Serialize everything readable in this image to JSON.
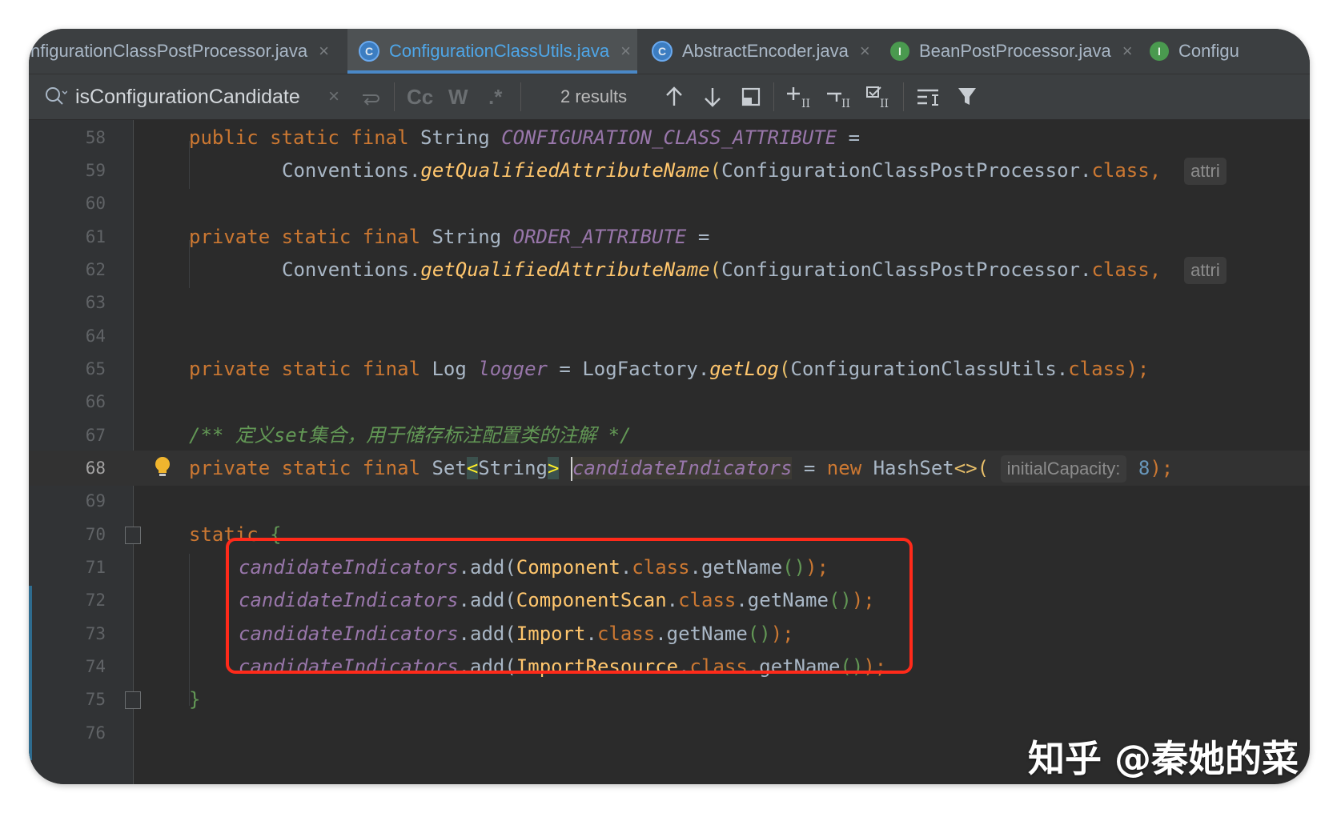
{
  "tabs": [
    {
      "label": "nfigurationClassPostProcessor.java",
      "icon": "class-icon",
      "active": false
    },
    {
      "label": "ConfigurationClassUtils.java",
      "icon": "class-icon",
      "active": true
    },
    {
      "label": "AbstractEncoder.java",
      "icon": "class-icon",
      "active": false
    },
    {
      "label": "BeanPostProcessor.java",
      "icon": "interface-icon",
      "active": false
    },
    {
      "label": "Configu",
      "icon": "interface-icon",
      "active": false
    }
  ],
  "tab_close_glyph": "×",
  "class_icon_glyph": "C",
  "interface_icon_glyph": "I",
  "search": {
    "query": "isConfigurationCandidate",
    "clear_glyph": "×",
    "match_case": "Cc",
    "words": "W",
    "regex": ".*",
    "results": "2 results"
  },
  "lines": {
    "n58": "58",
    "n59": "59",
    "n60": "60",
    "n61": "61",
    "n62": "62",
    "n63": "63",
    "n64": "64",
    "n65": "65",
    "n66": "66",
    "n67": "67",
    "n68": "68",
    "n69": "69",
    "n70": "70",
    "n71": "71",
    "n72": "72",
    "n73": "73",
    "n74": "74",
    "n75": "75",
    "n76": "76"
  },
  "code": {
    "kw_public": "public",
    "kw_private": "private",
    "kw_static": "static",
    "kw_final": "final",
    "kw_new": "new",
    "kw_class": "class",
    "t_string": "String",
    "t_log": "Log",
    "t_set": "Set",
    "c_config_attr": "CONFIGURATION_CLASS_ATTRIBUTE",
    "c_order_attr": "ORDER_ATTRIBUTE",
    "eq": " = ",
    "conventions": "Conventions.",
    "m_getqualified": "getQualifiedAttributeName",
    "ccpp": "ConfigurationClassPostProcessor.",
    "comma": ",",
    "hint_attr": "attri",
    "f_logger": "logger",
    "logfactory": "LogFactory.",
    "m_getlog": "getLog",
    "ccu": "ConfigurationClassUtils.",
    "close_semi": ");",
    "comment": "/** 定义set集合，用于储存标注配置类的注解 */",
    "generic_open": "<",
    "generic_close": ">",
    "f_candidate": "candidateIndicators",
    "hashset": "HashSet",
    "diamond": "<>",
    "hint_capacity": "initialCapacity:",
    "num_8": "8",
    "static_block": "static",
    "brace_open": "{",
    "brace_close": "}",
    "dot_add": ".add(",
    "a_component": "Component",
    "a_componentscan": "ComponentScan",
    "a_import": "Import",
    "a_importresource": "ImportResource",
    "dot": ".",
    "getname": "getName",
    "parens": "()",
    "end_call": ");",
    "open_paren": "(",
    "space": " "
  },
  "watermark": "知乎 @秦她的菜",
  "colors": {
    "background": "#2b2b2b",
    "keyword": "#cc7832",
    "constant": "#9876aa",
    "method": "#ffc66d",
    "annotation": "#bbb529",
    "comment": "#629755",
    "number": "#6897bb",
    "highlight_box": "#ff2a1a"
  }
}
